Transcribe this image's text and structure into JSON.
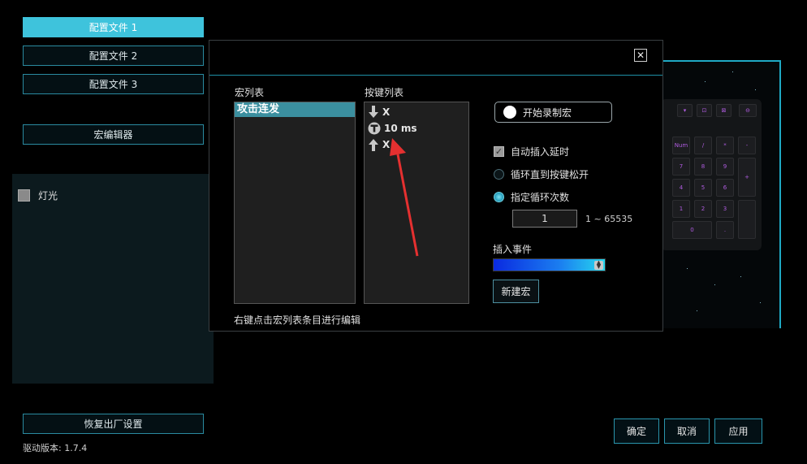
{
  "sidebar": {
    "profiles": [
      {
        "label": "配置文件 1",
        "active": true
      },
      {
        "label": "配置文件 2",
        "active": false
      },
      {
        "label": "配置文件 3",
        "active": false
      }
    ],
    "macro_editor_label": "宏编辑器",
    "lighting_label": "灯光",
    "reset_label": "恢复出厂设置",
    "driver_version": "驱动版本:  1.7.4"
  },
  "dialog": {
    "close_symbol": "✕",
    "macro_list_title": "宏列表",
    "macro_items": [
      "攻击连发"
    ],
    "key_list_title": "按键列表",
    "key_events": [
      {
        "icon": "arrow-down-icon",
        "text": "X"
      },
      {
        "icon": "timer-icon",
        "text": "10 ms"
      },
      {
        "icon": "arrow-up-icon",
        "text": "X"
      }
    ],
    "record_label": "开始录制宏",
    "auto_delay_label": "自动插入延时",
    "loop_until_release_label": "循环直到按键松开",
    "loop_count_label": "指定循环次数",
    "loop_count_value": "1",
    "loop_range": "1 ~ 65535",
    "insert_event_label": "插入事件",
    "new_macro_label": "新建宏",
    "hint": "右键点击宏列表条目进行编辑"
  },
  "footer": {
    "ok_label": "确定",
    "cancel_label": "取消",
    "apply_label": "应用"
  },
  "colors": {
    "accent": "#3ec3dc",
    "border": "#2a8aa0",
    "selected_item": "#3b8f9f",
    "annotation_arrow": "#e53030",
    "key_backlight": "#b05ce0"
  },
  "keyboard_keys": [
    "Num",
    "/",
    "*",
    "-",
    "7",
    "8",
    "9",
    "+",
    "4",
    "5",
    "6",
    "1",
    "2",
    "3",
    "0",
    "."
  ]
}
